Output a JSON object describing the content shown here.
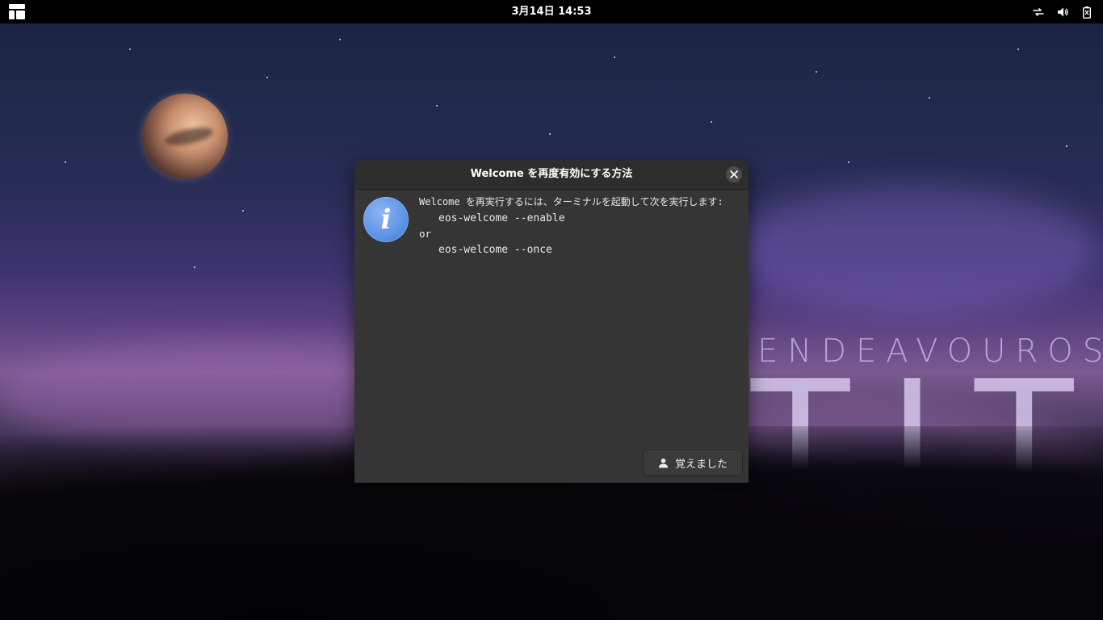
{
  "topbar": {
    "activities_icon": "activities-overview-icon",
    "clock": "3月14日  14:53",
    "tray_icons": [
      "network-wired-icon",
      "volume-icon",
      "battery-icon"
    ]
  },
  "wallpaper": {
    "brand_small": "ENDEAVOUROS",
    "brand_big": "TITAN"
  },
  "dialog": {
    "title": "Welcome を再度有効にする方法",
    "close_icon": "close-icon",
    "info_icon": "information-icon",
    "info_glyph": "i",
    "message": {
      "intro": "Welcome を再実行するには、ターミナルを起動して次を実行します:",
      "command1": "eos-welcome --enable",
      "or": "or",
      "command2": "eos-welcome --once"
    },
    "ok_button": {
      "label": "覚えました",
      "icon": "person-icon"
    }
  },
  "colors": {
    "topbar_bg": "#000000",
    "dialog_bg": "#353535",
    "header_bg": "#2d2d2d",
    "info_blue": "#5b94e6"
  }
}
